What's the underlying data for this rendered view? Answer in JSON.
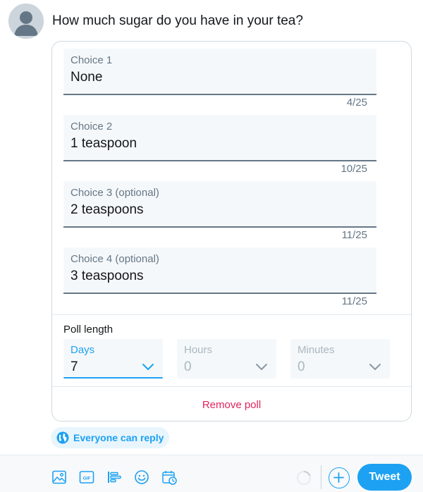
{
  "composer": {
    "question": "How much sugar do you have in your tea?"
  },
  "poll": {
    "choices": [
      {
        "label": "Choice 1",
        "value": "None",
        "count": "4/25"
      },
      {
        "label": "Choice 2",
        "value": "1 teaspoon",
        "count": "10/25"
      },
      {
        "label": "Choice 3 (optional)",
        "value": "2 teaspoons",
        "count": "11/25"
      },
      {
        "label": "Choice 4 (optional)",
        "value": "3 teaspoons",
        "count": "11/25"
      }
    ],
    "length": {
      "title": "Poll length",
      "days": {
        "label": "Days",
        "value": "7"
      },
      "hours": {
        "label": "Hours",
        "value": "0"
      },
      "minutes": {
        "label": "Minutes",
        "value": "0"
      }
    },
    "remove_label": "Remove poll"
  },
  "reply_setting": {
    "label": "Everyone can reply"
  },
  "toolbar": {
    "gif_label": "GIF",
    "tweet_label": "Tweet",
    "icons": [
      "image-icon",
      "gif-icon",
      "poll-icon",
      "emoji-icon",
      "schedule-icon"
    ]
  },
  "colors": {
    "accent": "#1da1f2",
    "danger": "#e0245e",
    "field_bg": "#f5f8fa",
    "muted_text": "#657786"
  }
}
